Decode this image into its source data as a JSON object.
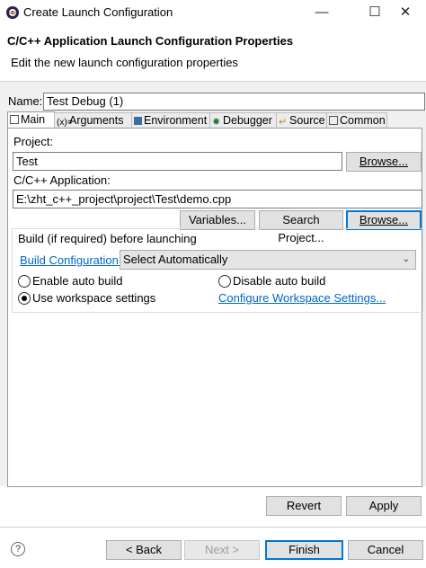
{
  "window": {
    "title": "Create Launch Configuration"
  },
  "header": {
    "title": "C/C++ Application Launch Configuration Properties",
    "subtitle": "Edit the new launch configuration properties"
  },
  "name": {
    "label": "Name:",
    "value": "Test Debug (1)"
  },
  "tabs": [
    {
      "label": "Main",
      "icon": "main-tab-icon",
      "active": true
    },
    {
      "label": "Arguments",
      "icon": "arguments-icon"
    },
    {
      "label": "Environment",
      "icon": "environment-icon"
    },
    {
      "label": "Debugger",
      "icon": "debugger-icon"
    },
    {
      "label": "Source",
      "icon": "source-icon"
    },
    {
      "label": "Common",
      "icon": "common-icon"
    }
  ],
  "main": {
    "project_label": "Project:",
    "project_value": "Test",
    "browse_label": "Browse...",
    "app_label": "C/C++ Application:",
    "app_value": "E:\\zht_c++_project\\project\\Test\\demo.cpp",
    "variables_label": "Variables...",
    "search_project_label": "Search Project...",
    "browse2_label": "Browse...",
    "build_group_title": "Build (if required) before launching",
    "build_config_link": "Build Configuration:",
    "build_config_value": "Select Automatically",
    "enable_auto_build": "Enable auto build",
    "disable_auto_build": "Disable auto build",
    "use_workspace": "Use workspace settings",
    "configure_workspace_link": "Configure Workspace Settings..."
  },
  "actions": {
    "revert_label": "Revert",
    "apply_label": "Apply"
  },
  "footer": {
    "back_label": "< Back",
    "next_label": "Next >",
    "finish_label": "Finish",
    "cancel_label": "Cancel",
    "help_glyph": "?"
  }
}
